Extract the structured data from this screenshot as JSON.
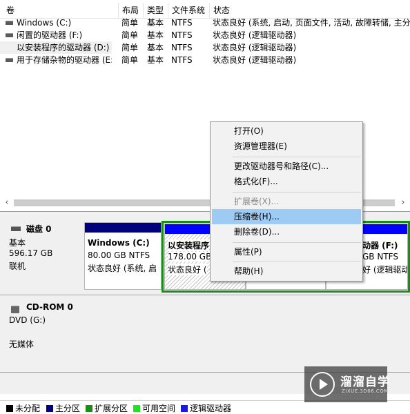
{
  "columns": [
    "卷",
    "布局",
    "类型",
    "文件系统",
    "状态"
  ],
  "volumes": [
    {
      "name": "Windows (C:)",
      "layout": "简单",
      "type": "基本",
      "fs": "NTFS",
      "status": "状态良好 (系统, 启动, 页面文件, 活动, 故障转储, 主分"
    },
    {
      "name": "闲置的驱动器 (F:)",
      "layout": "简单",
      "type": "基本",
      "fs": "NTFS",
      "status": "状态良好 (逻辑驱动器)"
    },
    {
      "name": "以安装程序的驱动器 (D:)",
      "layout": "简单",
      "type": "基本",
      "fs": "NTFS",
      "status": "状态良好 (逻辑驱动器)"
    },
    {
      "name": "用于存储杂物的驱动器 (E:)",
      "layout": "简单",
      "type": "基本",
      "fs": "NTFS",
      "status": "状态良好 (逻辑驱动器)"
    }
  ],
  "scroll": {
    "left": "‹",
    "right": "›"
  },
  "disk0": {
    "name": "磁盘 0",
    "kind": "基本",
    "size": "596.17 GB",
    "state": "联机",
    "partitions": [
      {
        "name": "Windows  (C:)",
        "size": "80.00 GB NTFS",
        "status": "状态良好 (系统, 启"
      },
      {
        "name": "以安装程序",
        "size": "178.00 GB",
        "status": "状态良好 ("
      },
      {
        "name": "动器  (F:)",
        "size": "GB NTFS",
        "status": "好 (逻辑驱动"
      }
    ]
  },
  "cdrom0": {
    "name": "CD-ROM 0",
    "drive": "DVD (G:)",
    "state": "无媒体"
  },
  "context_menu": [
    {
      "label": "打开(O)",
      "disabled": false
    },
    {
      "label": "资源管理器(E)",
      "disabled": false
    },
    {
      "label": "更改驱动器号和路径(C)...",
      "disabled": false
    },
    {
      "label": "格式化(F)...",
      "disabled": false
    },
    {
      "label": "扩展卷(X)...",
      "disabled": true
    },
    {
      "label": "压缩卷(H)...",
      "disabled": false,
      "highlighted": true
    },
    {
      "label": "删除卷(D)...",
      "disabled": false
    },
    {
      "label": "属性(P)",
      "disabled": false
    },
    {
      "label": "帮助(H)",
      "disabled": false
    }
  ],
  "legend": [
    {
      "label": "未分配",
      "color": "#000000"
    },
    {
      "label": "主分区",
      "color": "#00007d"
    },
    {
      "label": "扩展分区",
      "color": "#1a8c1a"
    },
    {
      "label": "可用空间",
      "color": "#22e022"
    },
    {
      "label": "逻辑驱动器",
      "color": "#1a1ae0"
    }
  ],
  "colors": {
    "primary": "#00007d",
    "logical": "#0000ff",
    "extended": "#1a8c1a",
    "highlight": "#9ecbf3"
  },
  "watermark": {
    "title": "溜溜自学",
    "url": "ZIXUE.3D66.COM"
  }
}
